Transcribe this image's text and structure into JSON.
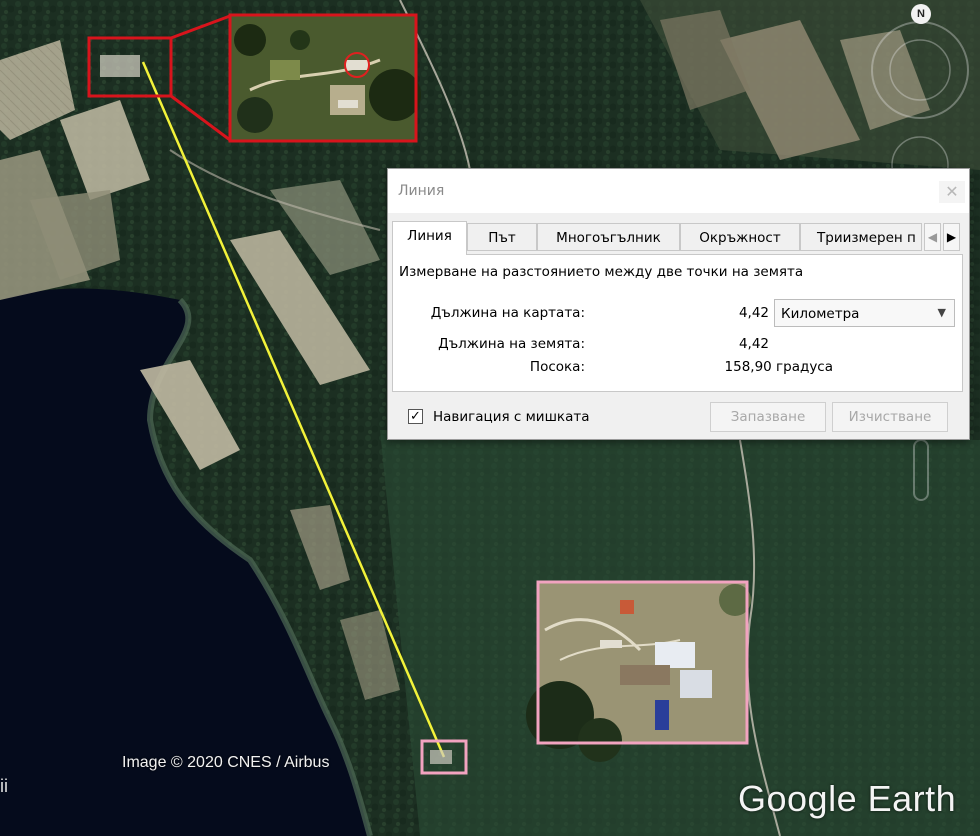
{
  "map": {
    "attribution": "Image © 2020 CNES / Airbus",
    "brand": "Google Earth",
    "compass_label": "N",
    "left_edge_glyph": "ii",
    "inset_top_color": "#d8141c",
    "inset_bottom_color": "#f2a3c0",
    "measure_line_color": "#f2f23a"
  },
  "dialog": {
    "title": "Линия",
    "close_icon": "close-icon",
    "tabs": [
      "Линия",
      "Път",
      "Многоъгълник",
      "Окръжност",
      "Триизмерен п"
    ],
    "active_tab": "Линия",
    "description": "Измерване на разстоянието между две точки на земята",
    "map_length_label": "Дължина на картата:",
    "map_length_value": "4,42",
    "unit": "Километра",
    "ground_length_label": "Дължина на земята:",
    "ground_length_value": "4,42",
    "heading_label": "Посока:",
    "heading_value": "158,90 градуса",
    "mouse_nav_label": "Навигация с мишката",
    "mouse_nav_checked": true,
    "save_button": "Запазване",
    "clear_button": "Изчистване"
  }
}
